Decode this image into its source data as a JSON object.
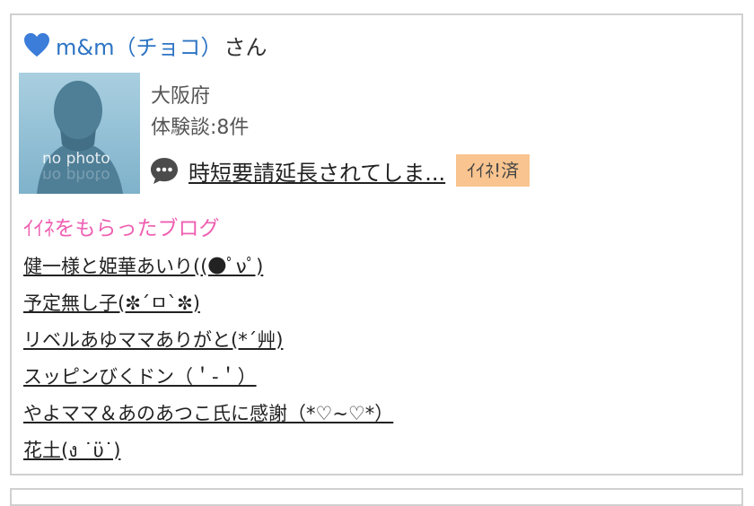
{
  "profile": {
    "name": "m&m（チョコ）",
    "suffix": "さん",
    "heart_color": "#3b7dd8",
    "photo_caption": "no photo",
    "prefecture": "大阪府",
    "experience_count": "体験談:8件"
  },
  "post": {
    "title": "時短要請延長されてしま...",
    "badge": "ｲｲﾈ!済",
    "icon": "speech-bubble-icon"
  },
  "liked_blogs": {
    "title": "ｲｲﾈをもらったブログ",
    "title_color": "#ee5fb1",
    "items": [
      {
        "label": "健一様と姫華あいり((●ﾟνﾟ)"
      },
      {
        "label": "予定無し子(✼´ㅁ`✼)"
      },
      {
        "label": "リベルあゆママありがと(*´艸)"
      },
      {
        "label": "スッピンびくドン（＇-＇）"
      },
      {
        "label": "やよママ＆あのあつこ氏に感謝（*♡~♡*）"
      },
      {
        "label": "花土(ง ˙ϋ˙)"
      }
    ]
  }
}
